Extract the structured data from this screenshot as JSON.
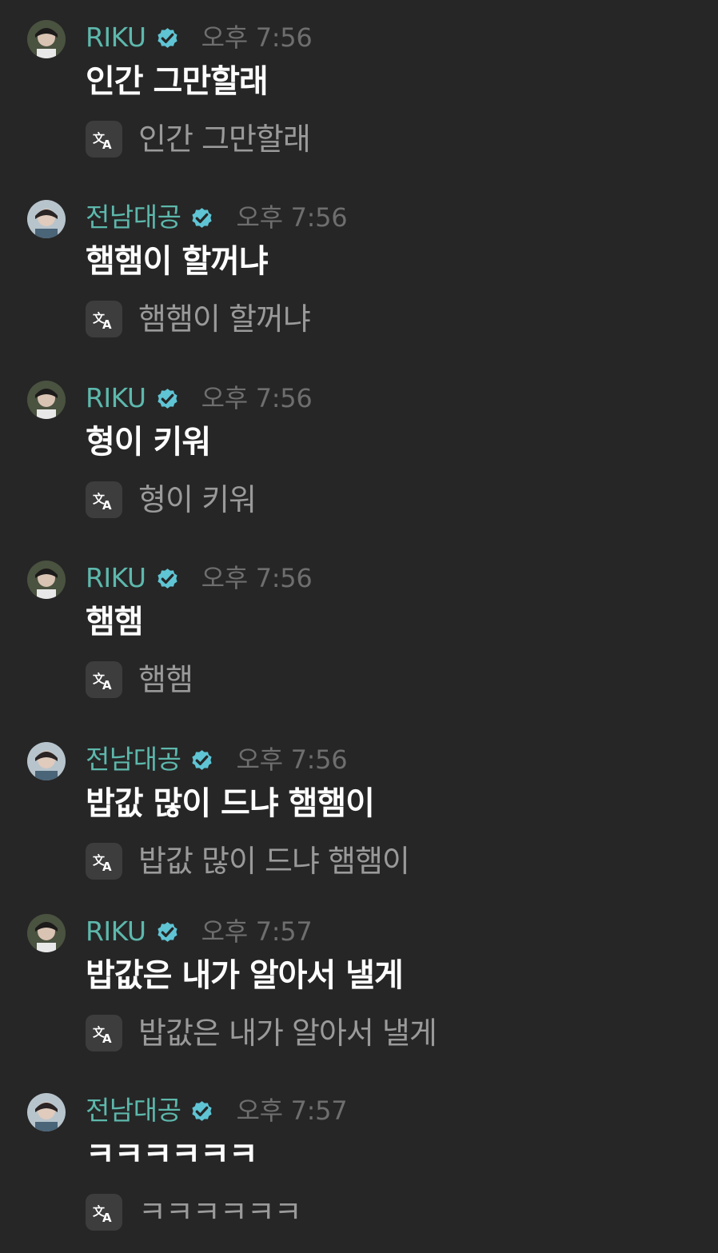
{
  "messages": [
    {
      "author": "RIKU",
      "verified": true,
      "avatar": "riku-avatar",
      "time": "오후 7:56",
      "text": "인간 그만할래",
      "translation": "인간 그만할래"
    },
    {
      "author": "전남대공",
      "verified": true,
      "avatar": "jeonnamdaegong-avatar",
      "time": "오후 7:56",
      "text": "햄햄이 할꺼냐",
      "translation": "햄햄이 할꺼냐"
    },
    {
      "author": "RIKU",
      "verified": true,
      "avatar": "riku-avatar",
      "time": "오후 7:56",
      "text": "형이 키워",
      "translation": "형이 키워"
    },
    {
      "author": "RIKU",
      "verified": true,
      "avatar": "riku-avatar",
      "time": "오후 7:56",
      "text": "햄햄",
      "translation": "햄햄"
    },
    {
      "author": "전남대공",
      "verified": true,
      "avatar": "jeonnamdaegong-avatar",
      "time": "오후 7:56",
      "text": "밥값 많이 드냐 햄햄이",
      "translation": "밥값 많이 드냐 햄햄이"
    },
    {
      "author": "RIKU",
      "verified": true,
      "avatar": "riku-avatar",
      "time": "오후 7:57",
      "text": "밥값은 내가 알아서 낼게",
      "translation": "밥값은 내가 알아서 낼게"
    },
    {
      "author": "전남대공",
      "verified": true,
      "avatar": "jeonnamdaegong-avatar",
      "time": "오후 7:57",
      "text": "ㅋㅋㅋㅋㅋㅋ",
      "translation": "ㅋㅋㅋㅋㅋㅋ"
    }
  ],
  "colors": {
    "background": "#262626",
    "author_name": "#5db8ac",
    "verified_badge": "#5fc4d4",
    "timestamp": "#6e6e6e",
    "message_text": "#ffffff",
    "translation_text": "#9a9a9a",
    "translate_button_bg": "#3d3d3d"
  },
  "icons": {
    "verified": "verified-badge-icon",
    "translate": "translate-icon"
  }
}
